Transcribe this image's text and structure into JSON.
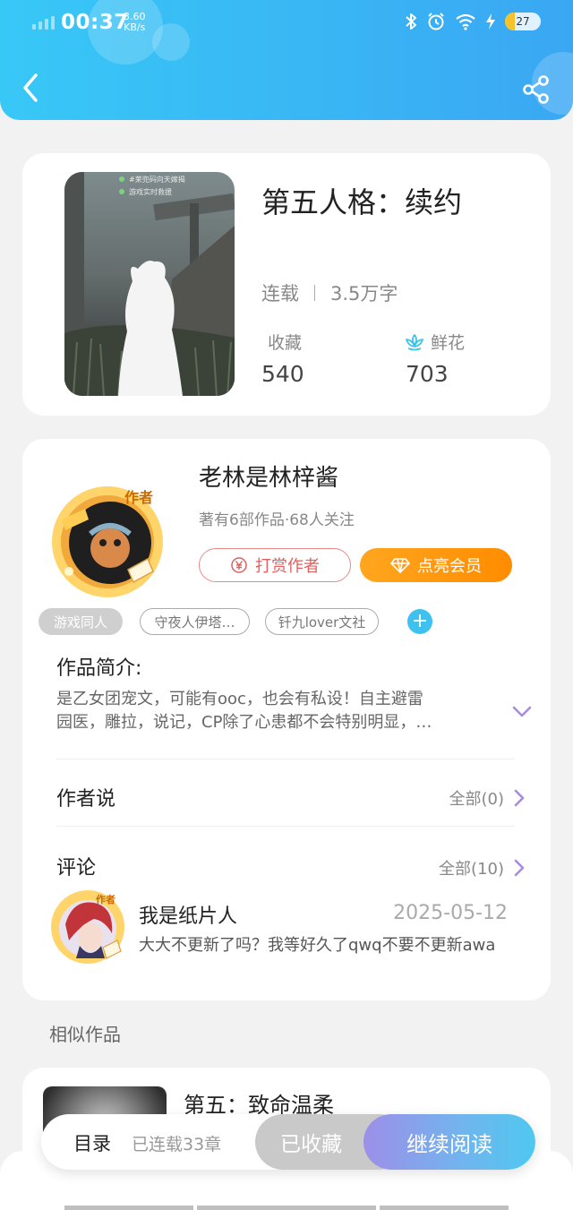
{
  "status_bar": {
    "time": "00:37",
    "speed_value": "3.60",
    "speed_unit": "KB/s",
    "battery": "27",
    "battery_level": 0.27
  },
  "book": {
    "title": "第五人格：续约",
    "status": "连载",
    "word_count": "3.5万字",
    "favorites_label": "收藏",
    "favorites_value": "540",
    "flowers_label": "鲜花",
    "flowers_value": "703",
    "cover_caption_1": "#莱兜码向天嫁揭",
    "cover_caption_2": "游戏实时救援"
  },
  "author": {
    "name": "老林是林梓酱",
    "meta": "著有6部作品·68人关注",
    "badge": "作者",
    "tip_button": "打赏作者",
    "vip_button": "点亮会员"
  },
  "tags": [
    "游戏同人",
    "守夜人伊塔…",
    "钎九lover文社"
  ],
  "intro": {
    "heading": "作品简介:",
    "line1": "是乙女团宠文，可能有ooc，也会有私设！自主避雷",
    "line2": "园医，雕拉，说记，CP除了心患都不会特别明显，…"
  },
  "author_says": {
    "heading": "作者说",
    "all_label": "全部(0)"
  },
  "comments": {
    "heading": "评论",
    "all_label": "全部(10)",
    "items": [
      {
        "badge": "作者",
        "name": "我是纸片人",
        "date": "2025-05-12",
        "text": "大大不更新了吗？我等好久了qwq不要不更新awa"
      }
    ]
  },
  "similar": {
    "heading": "相似作品",
    "items": [
      {
        "title": "第五：致命温柔"
      }
    ]
  },
  "bottom_bar": {
    "toc_label": "目录",
    "toc_count": "已连载33章",
    "collected_label": "已收藏",
    "read_label": "继续阅读"
  },
  "colors": {
    "header_start": "#38c8f6",
    "header_end": "#3aa7f3",
    "vip_orange": "#ff8c00",
    "tip_red": "#e06060",
    "accent_purple": "#a78be0"
  }
}
